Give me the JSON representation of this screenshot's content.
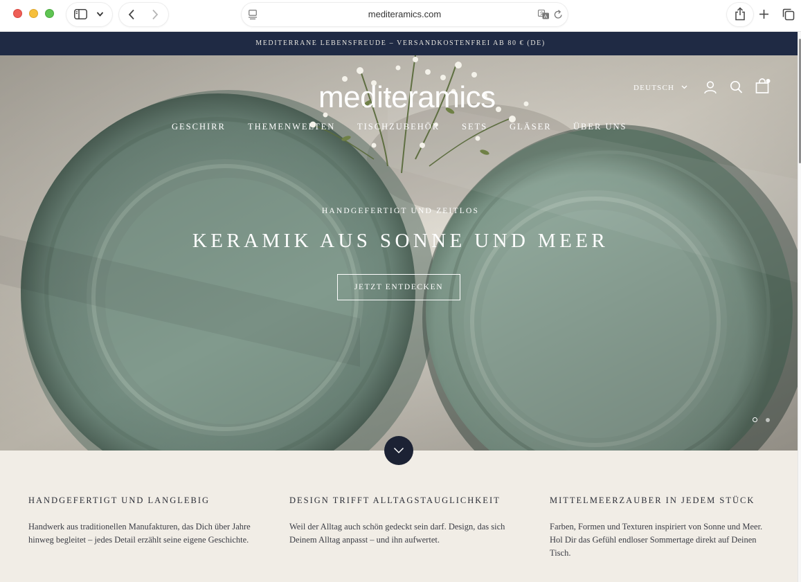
{
  "browser": {
    "url": "mediteramics.com",
    "icons": [
      "sidebar-icon",
      "chevron-down-icon",
      "back-icon",
      "forward-icon",
      "reader-icon",
      "translate-icon",
      "reload-icon",
      "share-icon",
      "new-tab-icon",
      "tabs-overview-icon"
    ]
  },
  "announcement": "MEDITERRANE LEBENSFREUDE – VERSANDKOSTENFREI AB 80 € (DE)",
  "header": {
    "logo": "mediteramics",
    "language": "DEUTSCH",
    "icons": [
      "account-icon",
      "search-icon",
      "cart-icon"
    ]
  },
  "nav": [
    {
      "label": "GESCHIRR"
    },
    {
      "label": "THEMENWELTEN"
    },
    {
      "label": "TISCHZUBEHÖR"
    },
    {
      "label": "SETS"
    },
    {
      "label": "GLÄSER"
    },
    {
      "label": "ÜBER UNS"
    }
  ],
  "hero": {
    "subtitle": "HANDGEFERTIGT UND ZEITLOS",
    "title": "KERAMIK AUS SONNE UND MEER",
    "cta": "JETZT ENTDECKEN",
    "slides_total": 2,
    "active_slide": 1
  },
  "features": [
    {
      "title": "HANDGEFERTIGT UND LANGLEBIG",
      "text": "Handwerk aus traditionellen Manufakturen, das Dich über Jahre hinweg begleitet – jedes Detail erzählt seine eigene Geschichte."
    },
    {
      "title": "DESIGN TRIFFT ALLTAGSTAUGLICHKEIT",
      "text": "Weil der Alltag auch schön gedeckt sein darf. Design, das sich Deinem Alltag anpasst – und ihn aufwertet."
    },
    {
      "title": "MITTELMEERZAUBER IN JEDEM STÜCK",
      "text": "Farben, Formen und Texturen inspiriert von Sonne und Meer. Hol Dir das Gefühl endloser Sommertage direkt auf Deinen Tisch."
    }
  ],
  "colors": {
    "announcement_bg": "#1f2a44",
    "features_bg": "#f1ede6",
    "plate_green": "#7e9488",
    "scroll_button": "#1c2234"
  }
}
